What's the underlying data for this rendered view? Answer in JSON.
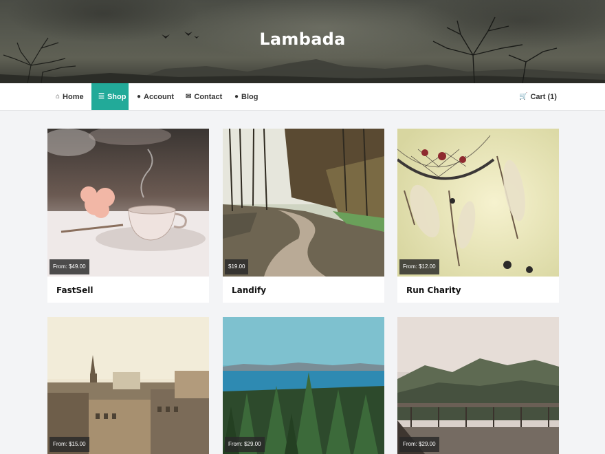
{
  "site": {
    "title": "Lambada"
  },
  "nav": {
    "items": [
      {
        "label": "Home",
        "icon": "home-icon",
        "active": false
      },
      {
        "label": "Shop",
        "icon": "menu-icon",
        "active": true
      },
      {
        "label": "Account",
        "icon": "user-icon",
        "active": false
      },
      {
        "label": "Contact",
        "icon": "envelope-icon",
        "active": false
      },
      {
        "label": "Blog",
        "icon": "comments-icon",
        "active": false
      }
    ],
    "cart": {
      "label": "Cart (1)",
      "icon": "cart-icon"
    }
  },
  "colors": {
    "accent": "#22aa99",
    "background": "#f3f4f6"
  },
  "products": [
    {
      "name": "FastSell",
      "price": "From: $49.00",
      "image": "tea-cup-flower-photo"
    },
    {
      "name": "Landify",
      "price": "$19.00",
      "image": "forest-road-photo"
    },
    {
      "name": "Run Charity",
      "price": "From: $12.00",
      "image": "dreamcatcher-photo"
    },
    {
      "name": "",
      "price": "From: $15.00",
      "image": "city-rooftops-photo"
    },
    {
      "name": "",
      "price": "From: $29.00",
      "image": "sea-pine-forest-photo"
    },
    {
      "name": "",
      "price": "From: $29.00",
      "image": "misty-forest-balcony-photo"
    }
  ]
}
